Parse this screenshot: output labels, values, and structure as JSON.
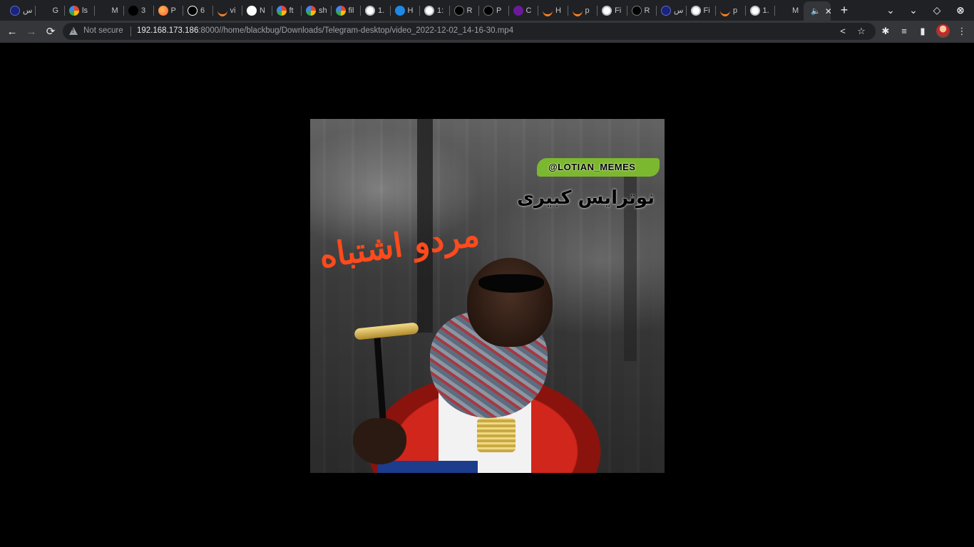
{
  "browser": {
    "tabs": [
      {
        "label": "س",
        "icon": "dark-circle-icon"
      },
      {
        "label": "G",
        "icon": "none"
      },
      {
        "label": "ls",
        "icon": "google-icon"
      },
      {
        "label": "M",
        "icon": "none"
      },
      {
        "label": "3",
        "icon": "medium-icon"
      },
      {
        "label": "P",
        "icon": "firefox-icon"
      },
      {
        "label": "6",
        "icon": "info-icon"
      },
      {
        "label": "vi",
        "icon": "stackoverflow-icon"
      },
      {
        "label": "N",
        "icon": "github-icon"
      },
      {
        "label": "ft",
        "icon": "google-icon"
      },
      {
        "label": "sh",
        "icon": "google-icon"
      },
      {
        "label": "fil",
        "icon": "google-icon"
      },
      {
        "label": "1.",
        "icon": "globe-icon"
      },
      {
        "label": "H",
        "icon": "leetcode-icon"
      },
      {
        "label": "1:",
        "icon": "globe-icon"
      },
      {
        "label": "R",
        "icon": "dark-dot-icon"
      },
      {
        "label": "P",
        "icon": "dark-dot-icon"
      },
      {
        "label": "C",
        "icon": "purple-square-icon"
      },
      {
        "label": "H",
        "icon": "stackoverflow-icon"
      },
      {
        "label": "p",
        "icon": "stackoverflow-icon"
      },
      {
        "label": "Fi",
        "icon": "globe-icon"
      },
      {
        "label": "R",
        "icon": "dark-dot-icon"
      },
      {
        "label": "س",
        "icon": "dark-circle-icon"
      },
      {
        "label": "Fi",
        "icon": "globe-icon"
      },
      {
        "label": "p",
        "icon": "stackoverflow-icon"
      },
      {
        "label": "1.",
        "icon": "globe-icon"
      },
      {
        "label": "M",
        "icon": "none"
      }
    ],
    "active_tab": {
      "icon": "speaker-icon",
      "close": "✕"
    },
    "new_tab": "+",
    "tab_search": "⌄",
    "omnibox": {
      "security_label": "Not secure",
      "url_host": "192.168.173.186",
      "url_rest": ":8000//home/blackbug/Downloads/Telegram-desktop/video_2022-12-02_14-16-30.mp4"
    }
  },
  "video": {
    "watermark": "@LOTIAN_MEMES",
    "caption_black": "نوترایس کبیری",
    "caption_red": "مردو اشتباه"
  },
  "colors": {
    "tabstrip_bg": "#202124",
    "toolbar_bg": "#35363a",
    "watermark_green": "#7cb82f",
    "caption_red": "#ff4a1c"
  }
}
